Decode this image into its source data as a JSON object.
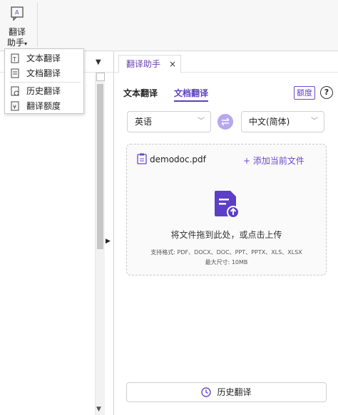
{
  "ribbon": {
    "assistant_line1": "翻译",
    "assistant_line2": "助手"
  },
  "dropdown": {
    "items": [
      {
        "label": "文本翻译",
        "icon": "text-translate-icon"
      },
      {
        "label": "文档翻译",
        "icon": "document-translate-icon"
      },
      {
        "label": "历史翻译",
        "icon": "history-icon"
      },
      {
        "label": "翻译额度",
        "icon": "quota-icon"
      }
    ]
  },
  "panel": {
    "tab_label": "翻译助手",
    "tab_close": "×",
    "segments": {
      "text": "文本翻译",
      "document": "文档翻译"
    },
    "quota_label": "额度",
    "help_label": "?",
    "source_lang": "英语",
    "target_lang": "中文(简体)",
    "dropzone": {
      "file_name": "demodoc.pdf",
      "add_label": "+ 添加当前文件",
      "drop_text": "将文件拖到此处，或点击上传",
      "formats": "支持格式: PDF、DOCX、DOC、PPT、PPTX、XLS、XLSX",
      "max_size": "最大尺寸: 10MB"
    },
    "history_button": "历史翻译"
  },
  "colors": {
    "accent": "#5b3fc4",
    "accent_light": "#b7a7ee"
  }
}
